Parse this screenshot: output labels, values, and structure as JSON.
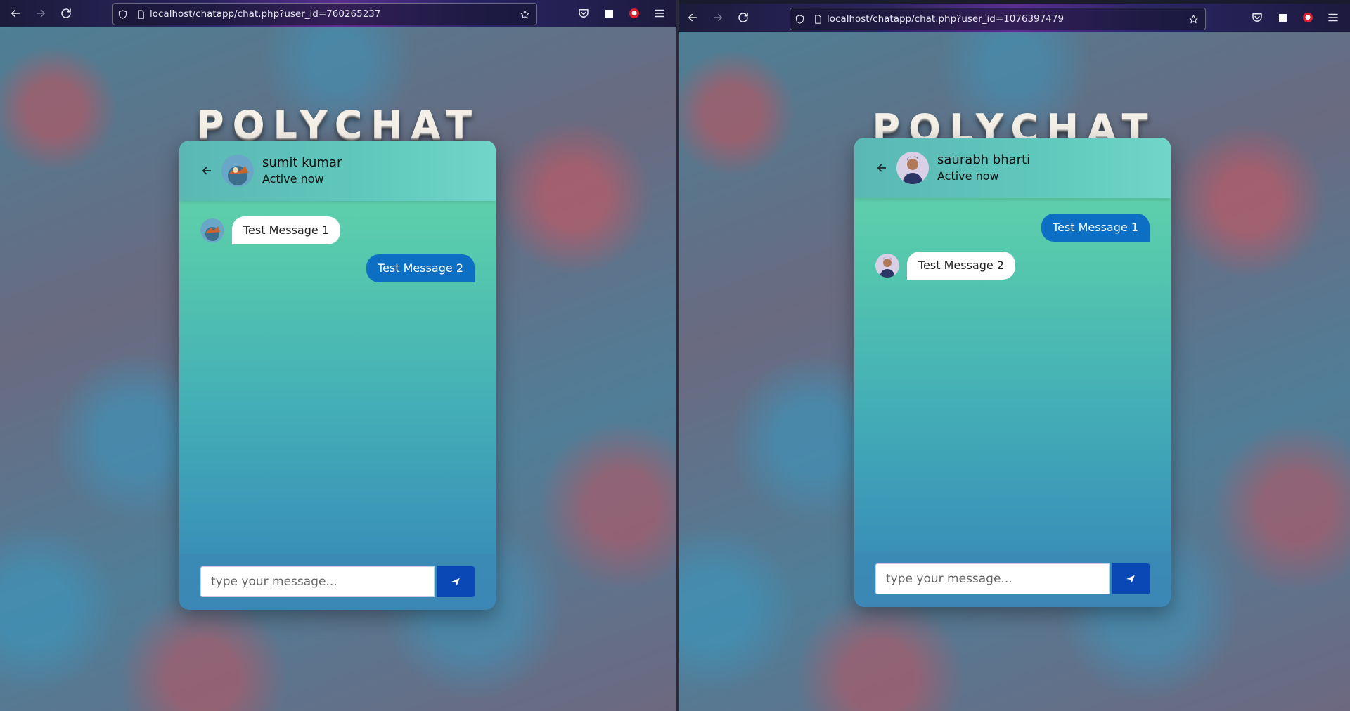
{
  "left_window": {
    "url": "localhost/chatapp/chat.php?user_id=760265237",
    "brand": "POLYCHAT",
    "contact": {
      "name": "sumit kumar",
      "status": "Active now"
    },
    "messages": [
      {
        "direction": "incoming",
        "text": "Test Message 1"
      },
      {
        "direction": "outgoing",
        "text": "Test Message 2"
      }
    ],
    "input_placeholder": "type your message..."
  },
  "right_window": {
    "url": "localhost/chatapp/chat.php?user_id=1076397479",
    "brand": "POLYCHAT",
    "contact": {
      "name": "saurabh bharti",
      "status": "Active now"
    },
    "messages": [
      {
        "direction": "outgoing",
        "text": "Test Message 1"
      },
      {
        "direction": "incoming",
        "text": "Test Message 2"
      }
    ],
    "input_placeholder": "type your message..."
  },
  "icons": {
    "back": "arrow-left-icon",
    "forward": "arrow-right-icon",
    "reload": "reload-icon",
    "shield": "shield-icon",
    "page": "page-icon",
    "bookmark": "star-icon",
    "pocket": "pocket-icon",
    "extension": "extension-icon",
    "lock_extension": "lock-icon",
    "menu": "hamburger-menu-icon",
    "send": "paper-plane-icon"
  },
  "colors": {
    "outgoing_bubble": "#0d6fc4",
    "incoming_bubble": "#ffffff",
    "send_button": "#0a48b5"
  }
}
